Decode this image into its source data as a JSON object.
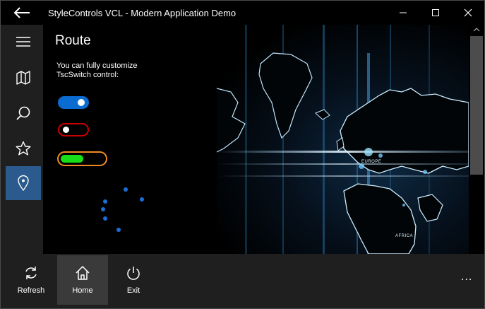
{
  "window": {
    "title": "StyleControls VCL - Modern Application Demo"
  },
  "rail": {
    "items": [
      {
        "name": "menu",
        "icon": "hamburger-icon"
      },
      {
        "name": "map",
        "icon": "map-icon"
      },
      {
        "name": "search",
        "icon": "search-icon"
      },
      {
        "name": "favorites",
        "icon": "star-icon"
      },
      {
        "name": "route",
        "icon": "location-pin-icon",
        "active": true
      }
    ]
  },
  "panel": {
    "title": "Route",
    "description": "You can fully customize TscSwitch control:",
    "switches": [
      {
        "state": "on",
        "color": "#0a6bd1"
      },
      {
        "state": "off",
        "border": "#c80000"
      },
      {
        "state": "on",
        "border": "#f08a24",
        "fill": "#18e018"
      }
    ]
  },
  "map": {
    "labels": {
      "europe": "EUROPE",
      "africa": "AFRICA"
    }
  },
  "appbar": {
    "buttons": [
      {
        "label": "Refresh",
        "icon": "refresh-icon"
      },
      {
        "label": "Home",
        "icon": "home-icon",
        "active": true
      },
      {
        "label": "Exit",
        "icon": "power-icon"
      }
    ],
    "more": "..."
  }
}
